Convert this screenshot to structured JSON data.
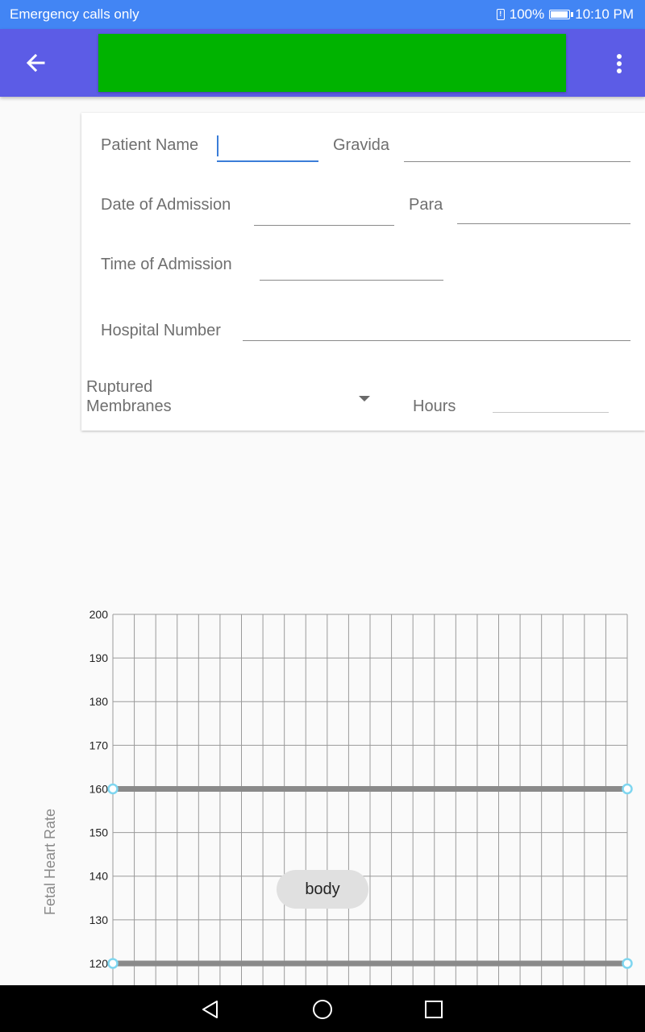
{
  "status_bar": {
    "carrier_text": "Emergency calls only",
    "battery_percent": "100%",
    "battery_level": 1.0,
    "time": "10:10 PM"
  },
  "app_bar": {
    "back_icon": "arrow-left-icon",
    "overflow_icon": "more-vert-icon",
    "brand_color": "#00b300",
    "bar_color": "#5c5ce6"
  },
  "form": {
    "patient_name": {
      "label": "Patient Name",
      "value": ""
    },
    "gravida": {
      "label": "Gravida",
      "value": ""
    },
    "date_of_admission": {
      "label": "Date of Admission",
      "value": ""
    },
    "para": {
      "label": "Para",
      "value": ""
    },
    "time_of_admission": {
      "label": "Time of Admission",
      "value": ""
    },
    "hospital_number": {
      "label": "Hospital Number",
      "value": ""
    },
    "ruptured_membranes": {
      "label_line1": "Ruptured",
      "label_line2": "Membranes",
      "selected": ""
    },
    "hours": {
      "label": "Hours",
      "value": ""
    }
  },
  "chart_data": {
    "type": "line",
    "ylabel": "Fetal Heart Rate",
    "yticks": [
      200,
      190,
      180,
      170,
      160,
      150,
      140,
      130,
      120
    ],
    "ylim": [
      200,
      115
    ],
    "grid": true,
    "vertical_grid_count": 24,
    "reference_lines": [
      {
        "y": 160,
        "color": "#8a8a8a"
      },
      {
        "y": 120,
        "color": "#8a8a8a"
      }
    ],
    "handle_color": "#7fd6f0"
  },
  "tooltip": {
    "text": "body"
  },
  "nav_bar": {
    "back": "nav-back-icon",
    "home": "nav-home-icon",
    "recents": "nav-recents-icon"
  }
}
